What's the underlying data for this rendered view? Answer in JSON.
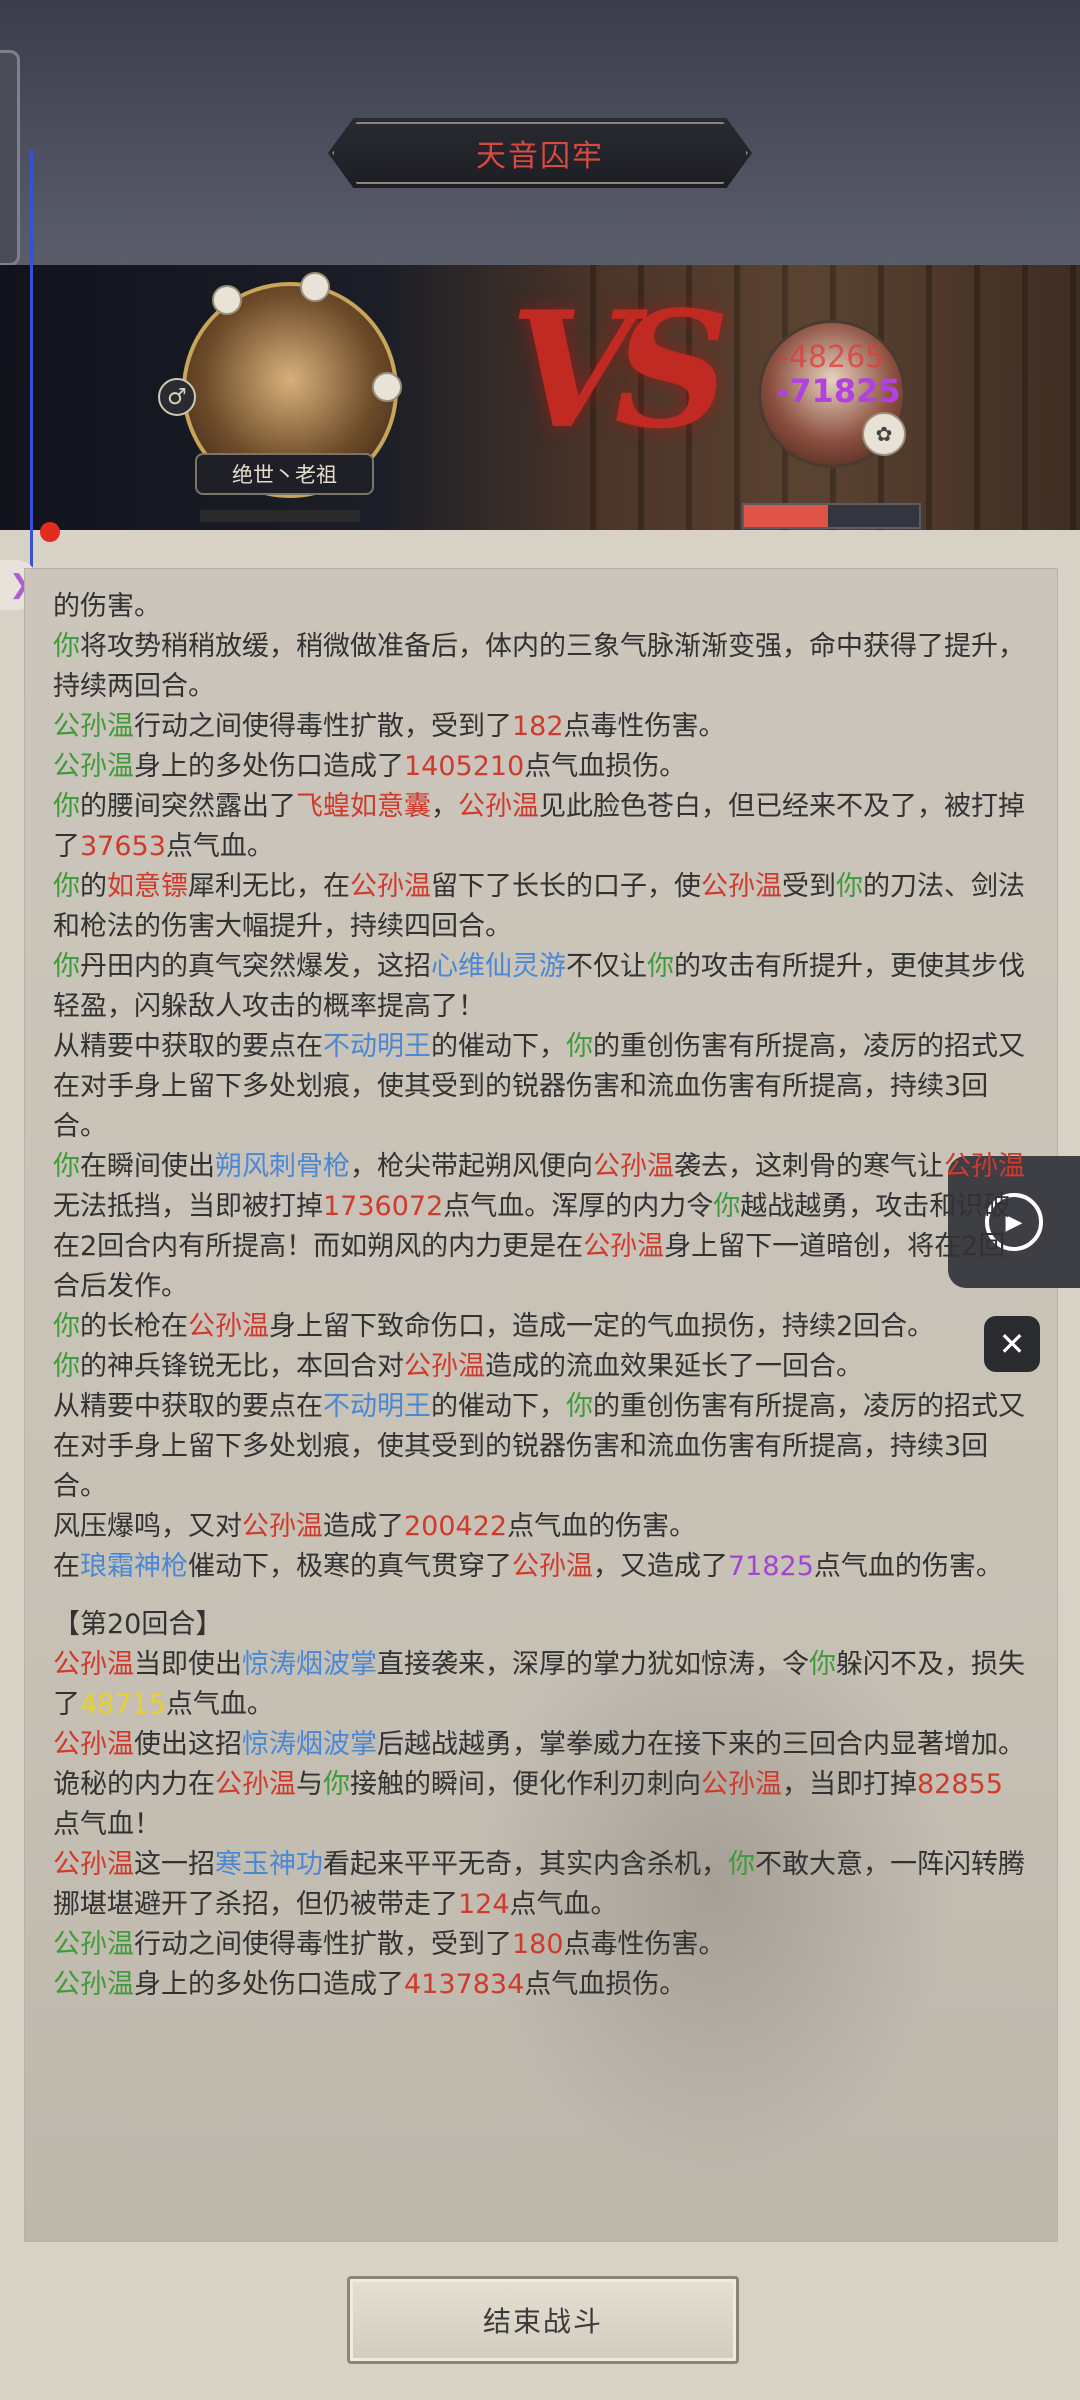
{
  "header": {
    "title": "天音囚牢"
  },
  "player": {
    "name": "绝世丶老祖",
    "gender_icon": "male-icon"
  },
  "enemy": {
    "hit_numbers": [
      "-48265",
      "-71825"
    ],
    "hp_fraction": 0.48
  },
  "vs_label": "VS",
  "log": [
    [
      {
        "t": "的伤害。"
      }
    ],
    [
      {
        "t": "你",
        "c": "g"
      },
      {
        "t": "将攻势稍稍放缓，稍微做准备后，体内的三象气脉渐渐变强，命中获得了提升，持续两回合。"
      }
    ],
    [
      {
        "t": "公孙温",
        "c": "g"
      },
      {
        "t": "行动之间使得毒性扩散，受到了"
      },
      {
        "t": "182",
        "c": "r"
      },
      {
        "t": "点毒性伤害。"
      }
    ],
    [
      {
        "t": "公孙温",
        "c": "g"
      },
      {
        "t": "身上的多处伤口造成了"
      },
      {
        "t": "1405210",
        "c": "r"
      },
      {
        "t": "点气血损伤。"
      }
    ],
    [
      {
        "t": "你",
        "c": "g"
      },
      {
        "t": "的腰间突然露出了"
      },
      {
        "t": "飞蝗如意囊",
        "c": "r"
      },
      {
        "t": "，"
      },
      {
        "t": "公孙温",
        "c": "r"
      },
      {
        "t": "见此脸色苍白，但已经来不及了，被打掉了"
      },
      {
        "t": "37653",
        "c": "r"
      },
      {
        "t": "点气血。"
      }
    ],
    [
      {
        "t": "你",
        "c": "g"
      },
      {
        "t": "的"
      },
      {
        "t": "如意镖",
        "c": "r"
      },
      {
        "t": "犀利无比，在"
      },
      {
        "t": "公孙温",
        "c": "r"
      },
      {
        "t": "留下了长长的口子，使"
      },
      {
        "t": "公孙温",
        "c": "r"
      },
      {
        "t": "受到"
      },
      {
        "t": "你",
        "c": "g"
      },
      {
        "t": "的刀法、剑法和枪法的伤害大幅提升，持续四回合。"
      }
    ],
    [
      {
        "t": "你",
        "c": "g"
      },
      {
        "t": "丹田内的真气突然爆发，这招"
      },
      {
        "t": "心维仙灵游",
        "c": "b"
      },
      {
        "t": "不仅让"
      },
      {
        "t": "你",
        "c": "g"
      },
      {
        "t": "的攻击有所提升，更使其步伐轻盈，闪躲敌人攻击的概率提高了！"
      }
    ],
    [
      {
        "t": "从精要中获取的要点在"
      },
      {
        "t": "不动明王",
        "c": "b"
      },
      {
        "t": "的催动下，"
      },
      {
        "t": "你",
        "c": "g"
      },
      {
        "t": "的重创伤害有所提高，凌厉的招式又在对手身上留下多处划痕，使其受到的锐器伤害和流血伤害有所提高，持续3回合。"
      }
    ],
    [
      {
        "t": "你",
        "c": "g"
      },
      {
        "t": "在瞬间使出"
      },
      {
        "t": "朔风刺骨枪",
        "c": "b"
      },
      {
        "t": "，枪尖带起朔风便向"
      },
      {
        "t": "公孙温",
        "c": "r"
      },
      {
        "t": "袭去，这刺骨的寒气让"
      },
      {
        "t": "公孙温",
        "c": "r"
      },
      {
        "t": "无法抵挡，当即被打掉"
      },
      {
        "t": "1736072",
        "c": "r"
      },
      {
        "t": "点气血。浑厚的内力令"
      },
      {
        "t": "你",
        "c": "g"
      },
      {
        "t": "越战越勇，攻击和识破在2回合内有所提高！而如朔风的内力更是在"
      },
      {
        "t": "公孙温",
        "c": "r"
      },
      {
        "t": "身上留下一道暗创，将在2回合后发作。"
      }
    ],
    [
      {
        "t": "你",
        "c": "g"
      },
      {
        "t": "的长枪在"
      },
      {
        "t": "公孙温",
        "c": "r"
      },
      {
        "t": "身上留下致命伤口，造成一定的气血损伤，持续2回合。"
      }
    ],
    [
      {
        "t": "你",
        "c": "g"
      },
      {
        "t": "的神兵锋锐无比，本回合对"
      },
      {
        "t": "公孙温",
        "c": "r"
      },
      {
        "t": "造成的流血效果延长了一回合。"
      }
    ],
    [
      {
        "t": "从精要中获取的要点在"
      },
      {
        "t": "不动明王",
        "c": "b"
      },
      {
        "t": "的催动下，"
      },
      {
        "t": "你",
        "c": "g"
      },
      {
        "t": "的重创伤害有所提高，凌厉的招式又在对手身上留下多处划痕，使其受到的锐器伤害和流血伤害有所提高，持续3回合。"
      }
    ],
    [
      {
        "t": "风压爆鸣，又对"
      },
      {
        "t": "公孙温",
        "c": "r"
      },
      {
        "t": "造成了"
      },
      {
        "t": "200422",
        "c": "r"
      },
      {
        "t": "点气血的伤害。"
      }
    ],
    [
      {
        "t": "在"
      },
      {
        "t": "琅霜神枪",
        "c": "b"
      },
      {
        "t": "催动下，极寒的真气贯穿了"
      },
      {
        "t": "公孙温",
        "c": "r"
      },
      {
        "t": "，又造成了"
      },
      {
        "t": "71825",
        "c": "p"
      },
      {
        "t": "点气血的伤害。"
      }
    ],
    {
      "section": "【第20回合】"
    },
    [
      {
        "t": "公孙温",
        "c": "r"
      },
      {
        "t": "当即使出"
      },
      {
        "t": "惊涛烟波掌",
        "c": "b"
      },
      {
        "t": "直接袭来，深厚的掌力犹如惊涛，令"
      },
      {
        "t": "你",
        "c": "g"
      },
      {
        "t": "躲闪不及，损失了"
      },
      {
        "t": "48715",
        "c": "y"
      },
      {
        "t": "点气血。"
      }
    ],
    [
      {
        "t": "公孙温",
        "c": "r"
      },
      {
        "t": "使出这招"
      },
      {
        "t": "惊涛烟波掌",
        "c": "b"
      },
      {
        "t": "后越战越勇，掌拳威力在接下来的三回合内显著增加。"
      }
    ],
    [
      {
        "t": "诡秘的内力在"
      },
      {
        "t": "公孙温",
        "c": "r"
      },
      {
        "t": "与"
      },
      {
        "t": "你",
        "c": "g"
      },
      {
        "t": "接触的瞬间，便化作利刃刺向"
      },
      {
        "t": "公孙温",
        "c": "r"
      },
      {
        "t": "，当即打掉"
      },
      {
        "t": "82855",
        "c": "r"
      },
      {
        "t": "点气血！"
      }
    ],
    [
      {
        "t": "公孙温",
        "c": "r"
      },
      {
        "t": "这一招"
      },
      {
        "t": "寒玉神功",
        "c": "b"
      },
      {
        "t": "看起来平平无奇，其实内含杀机，"
      },
      {
        "t": "你",
        "c": "g"
      },
      {
        "t": "不敢大意，一阵闪转腾挪堪堪避开了杀招，但仍被带走了"
      },
      {
        "t": "124",
        "c": "r"
      },
      {
        "t": "点气血。"
      }
    ],
    [
      {
        "t": "公孙温",
        "c": "g"
      },
      {
        "t": "行动之间使得毒性扩散，受到了"
      },
      {
        "t": "180",
        "c": "r"
      },
      {
        "t": "点毒性伤害。"
      }
    ],
    [
      {
        "t": "公孙温",
        "c": "g"
      },
      {
        "t": "身上的多处伤口造成了"
      },
      {
        "t": "4137834",
        "c": "r"
      },
      {
        "t": "点气血损伤。"
      }
    ]
  ],
  "controls": {
    "play_icon": "play-icon",
    "close_icon": "close-icon"
  },
  "end_button": {
    "label": "结束战斗"
  }
}
